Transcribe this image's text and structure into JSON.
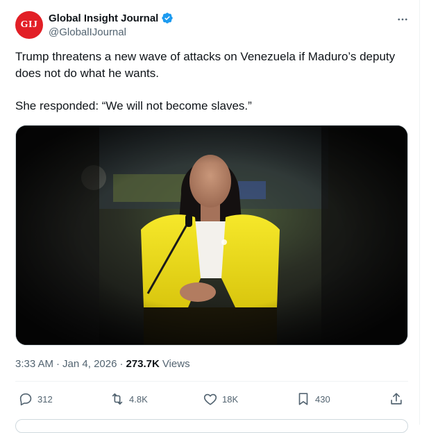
{
  "account": {
    "display_name": "Global Insight Journal",
    "handle": "@GlobalIJournal",
    "avatar_text": "GIJ",
    "avatar_color": "#e21f26",
    "verified_color": "#1d9bf0",
    "verified_icon": "verified-badge-icon",
    "more_icon": "more-horizontal-icon"
  },
  "tweet": {
    "text_line1": "Trump threatens a new wave of attacks on Venezuela if Maduro’s deputy does not do what he wants.",
    "text_line2": "She responded: “We will not become slaves.”",
    "media_description_icon": "photo-media"
  },
  "meta": {
    "time": "3:33 AM",
    "separator": "·",
    "date": "Jan 4, 2026",
    "views_count": "273.7K",
    "views_label": "Views"
  },
  "actions": {
    "replies": {
      "icon": "reply-icon",
      "count": "312"
    },
    "reposts": {
      "icon": "repost-icon",
      "count": "4.8K"
    },
    "likes": {
      "icon": "like-icon",
      "count": "18K"
    },
    "bookmarks": {
      "icon": "bookmark-icon",
      "count": "430"
    },
    "share": {
      "icon": "share-icon"
    }
  },
  "colors": {
    "text_primary": "#0f1419",
    "text_secondary": "#536471",
    "border": "#cfd9de",
    "blazer_yellow": "#f2e11a"
  }
}
